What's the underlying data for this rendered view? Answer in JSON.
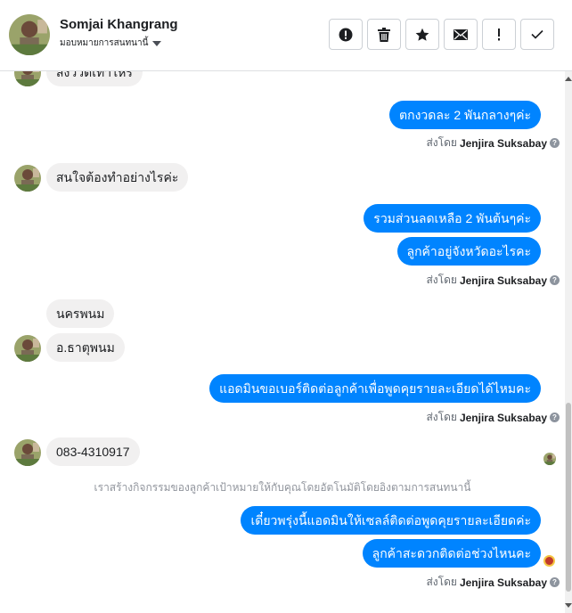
{
  "header": {
    "contact_name": "Somjai Khangrang",
    "assign_label": "มอบหมายการสนทนานี้",
    "actions": [
      {
        "name": "report-button",
        "icon": "exclamation-circle-icon"
      },
      {
        "name": "delete-button",
        "icon": "trash-icon"
      },
      {
        "name": "star-button",
        "icon": "star-icon"
      },
      {
        "name": "mark-unread-button",
        "icon": "envelope-icon"
      },
      {
        "name": "follow-up-button",
        "icon": "exclamation-icon"
      },
      {
        "name": "mark-done-button",
        "icon": "check-icon"
      }
    ]
  },
  "messages": {
    "m1": "ส่งวิวดีเท่าไหร่",
    "m2": "ตกงวดละ 2 พันกลางๆค่ะ",
    "m3": "สนใจต้องทำอย่างไรค่ะ",
    "m4": "รวมส่วนลดเหลือ 2 พันต้นๆค่ะ",
    "m5": "ลูกค้าอยู่จังหวัดอะไรคะ",
    "m6": "นครพนม",
    "m7": "อ.ธาตุพนม",
    "m8": "แอดมินขอเบอร์ติดต่อลูกค้าเพื่อพูดคุยรายละเอียดได้ไหมคะ",
    "m9": "083-4310917",
    "m10": "เดี๋ยวพรุ่งนี้แอดมินให้เซลล์ติดต่อพูดคุยรายละเอียดค่ะ",
    "m11": "ลูกค้าสะดวกติดต่อช่วงไหนคะ"
  },
  "sent_by": {
    "prefix": "ส่งโดย",
    "name": "Jenjira Suksabay",
    "help_glyph": "?"
  },
  "system_note": "เราสร้างกิจกรรมของลูกค้าเป้าหมายให้กับคุณโดยอัตโนมัติโดยอิงตามการสนทนานี้",
  "colors": {
    "outgoing_bubble": "#0084ff",
    "incoming_bubble": "#f1f0f0",
    "text": "#1c1e21",
    "muted": "#606770"
  }
}
